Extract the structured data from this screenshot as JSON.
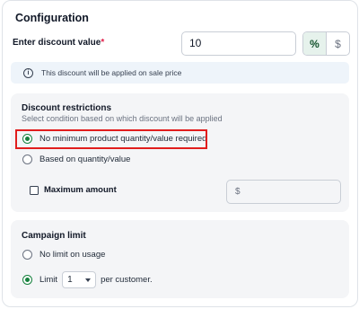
{
  "card": {
    "title": "Configuration"
  },
  "discount": {
    "label": "Enter discount value",
    "required_mark": "*",
    "value": "10",
    "type_options": [
      "%",
      "$"
    ],
    "selected_type": "%"
  },
  "info": {
    "icon": "info-icon",
    "text": "This discount will be applied on sale price"
  },
  "restrictions": {
    "title": "Discount restrictions",
    "subtitle": "Select condition based on which discount will be applied",
    "options": [
      {
        "label": "No minimum product quantity/value required",
        "checked": true
      },
      {
        "label": "Based on quantity/value",
        "checked": false
      }
    ],
    "max_amount": {
      "label": "Maximum amount",
      "checked": false,
      "placeholder": "$"
    }
  },
  "campaign_limit": {
    "title": "Campaign limit",
    "options": [
      {
        "label": "No limit on usage",
        "checked": false
      },
      {
        "label": "Limit",
        "checked": true
      }
    ],
    "limit_value": "1",
    "suffix": "per customer."
  },
  "colors": {
    "accent": "#15803d",
    "highlight": "#e11d1d",
    "required": "#e11d48"
  }
}
